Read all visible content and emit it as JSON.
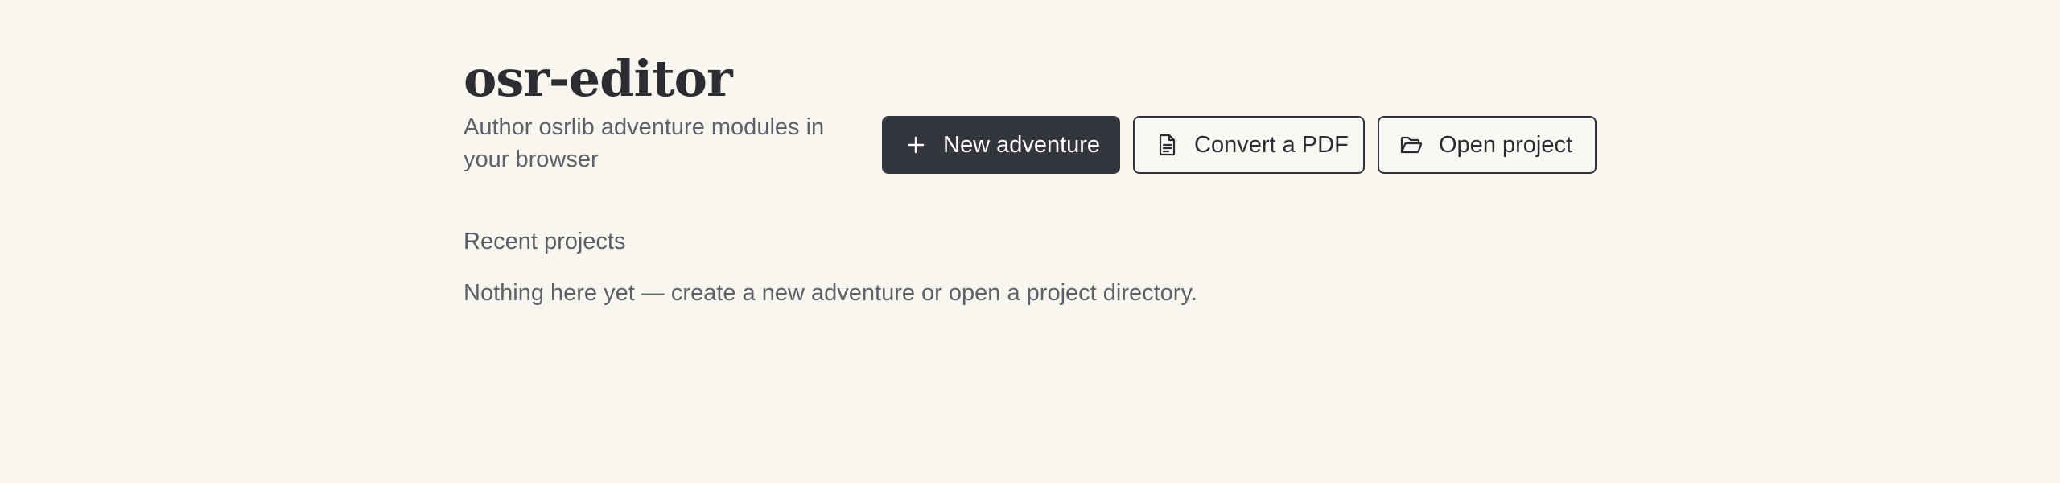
{
  "app": {
    "title": "osr-editor",
    "subtitle": "Author osrlib adventure modules in your browser"
  },
  "actions": {
    "new_adventure": {
      "label": "New adventure",
      "icon": "plus-icon"
    },
    "convert_pdf": {
      "label": "Convert a PDF",
      "icon": "document-icon"
    },
    "open_project": {
      "label": "Open project",
      "icon": "folder-open-icon"
    }
  },
  "recent": {
    "heading": "Recent projects",
    "empty_message": "Nothing here yet — create a new adventure or open a project directory."
  },
  "colors": {
    "background": "#f8f6ef",
    "primary_button": "#33363d",
    "text": "#2b2d33",
    "muted_text": "#5f6168"
  }
}
